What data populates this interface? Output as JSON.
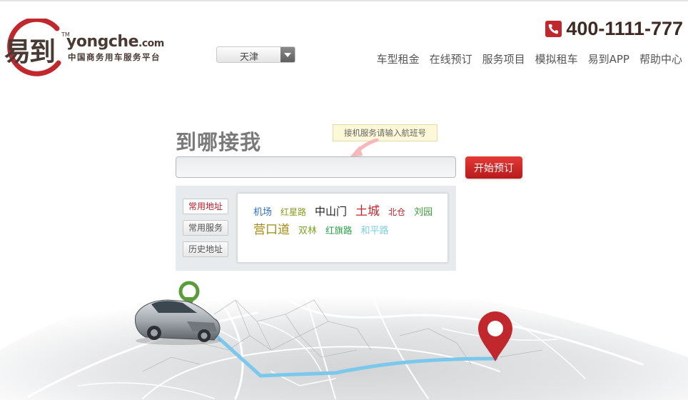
{
  "brand": {
    "name_cn": "易到",
    "name_en_main": "yongche",
    "name_en_tld": ".com",
    "trademark": "TM",
    "tagline": "中国商务用车服务平台",
    "accent_color": "#c0282d"
  },
  "city_select": {
    "selected": "天津"
  },
  "hotline": {
    "number": "400-1111-777",
    "icon": "phone-icon"
  },
  "nav": {
    "items": [
      {
        "label": "车型租金"
      },
      {
        "label": "在线预订"
      },
      {
        "label": "服务项目"
      },
      {
        "label": "模拟租车"
      },
      {
        "label": "易到APP"
      },
      {
        "label": "帮助中心"
      }
    ]
  },
  "booking": {
    "title": "到哪接我",
    "tooltip": "接机服务请输入航班号",
    "address_value": "",
    "submit_label": "开始预订"
  },
  "address_panel": {
    "tabs": [
      {
        "label": "常用地址",
        "active": true
      },
      {
        "label": "常用服务",
        "active": false
      },
      {
        "label": "历史地址",
        "active": false
      }
    ],
    "tags": [
      {
        "text": "机场",
        "color": "#2d6fbf"
      },
      {
        "text": "红星路",
        "color": "#8a9a1d"
      },
      {
        "text": "中山门",
        "color": "#222222"
      },
      {
        "text": "土城",
        "color": "#c0282d"
      },
      {
        "text": "北仓",
        "color": "#b0282d"
      },
      {
        "text": "刘园",
        "color": "#3c9a3c"
      },
      {
        "text": "营口道",
        "color": "#a28b10"
      },
      {
        "text": "双林",
        "color": "#7da52a"
      },
      {
        "text": "红旗路",
        "color": "#2aa04a"
      },
      {
        "text": "和平路",
        "color": "#79cfe0"
      }
    ]
  },
  "map": {
    "start_pin_color": "#5b9c3a",
    "end_pin_color": "#c0282d",
    "route_color": "#7cc8ec"
  }
}
